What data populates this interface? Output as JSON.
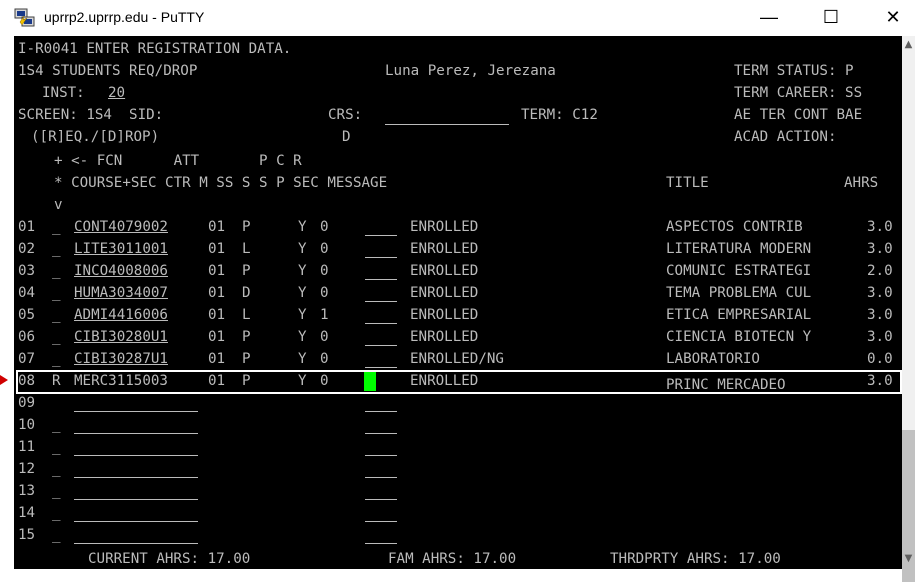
{
  "window": {
    "title": "uprrp2.uprrp.edu - PuTTY",
    "minimize_glyph": "—",
    "maximize_glyph": "☐",
    "close_glyph": "✕",
    "icon": "putty-icon"
  },
  "header": {
    "line1": "I-R0041 ENTER REGISTRATION DATA.",
    "program": "1S4 STUDENTS REQ/DROP",
    "student_name": "Luna Perez, Jerezana",
    "term_status": "TERM STATUS: P",
    "inst_label": "INST:",
    "inst_value": "20",
    "term_career": "TERM CAREER: SS",
    "screen_sid": "SCREEN: 1S4  SID:",
    "crs_label": "CRS:",
    "term_label": "TERM: C12",
    "ae_ter": "AE TER CONT BAE",
    "req_drop": "([R]EQ./[D]ROP)",
    "d_marker": "D",
    "acad_action": "ACAD ACTION:"
  },
  "columns": {
    "row1": "+ <- FCN      ATT       P C R",
    "row2": "* COURSE+SEC CTR M SS S S P SEC MESSAGE",
    "title": "TITLE",
    "ahrs": "AHRS",
    "row3": "v"
  },
  "rows": [
    {
      "num": "01",
      "fcn": "_",
      "course": "CONT4079002",
      "ctr": "01",
      "m": "P",
      "ps": "Y",
      "cs": "0",
      "message": "ENROLLED",
      "title": "ASPECTOS CONTRIB",
      "ahrs": "3.0"
    },
    {
      "num": "02",
      "fcn": "_",
      "course": "LITE3011001",
      "ctr": "01",
      "m": "L",
      "ps": "Y",
      "cs": "0",
      "message": "ENROLLED",
      "title": "LITERATURA MODERN",
      "ahrs": "3.0"
    },
    {
      "num": "03",
      "fcn": "_",
      "course": "INCO4008006",
      "ctr": "01",
      "m": "P",
      "ps": "Y",
      "cs": "0",
      "message": "ENROLLED",
      "title": "COMUNIC ESTRATEGI",
      "ahrs": "2.0"
    },
    {
      "num": "04",
      "fcn": "_",
      "course": "HUMA3034007",
      "ctr": "01",
      "m": "D",
      "ps": "Y",
      "cs": "0",
      "message": "ENROLLED",
      "title": "TEMA PROBLEMA CUL",
      "ahrs": "3.0"
    },
    {
      "num": "05",
      "fcn": "_",
      "course": "ADMI4416006",
      "ctr": "01",
      "m": "L",
      "ps": "Y",
      "cs": "1",
      "message": "ENROLLED",
      "title": "ETICA EMPRESARIAL",
      "ahrs": "3.0"
    },
    {
      "num": "06",
      "fcn": "_",
      "course": "CIBI30280U1",
      "ctr": "01",
      "m": "P",
      "ps": "Y",
      "cs": "0",
      "message": "ENROLLED",
      "title": "CIENCIA BIOTECN Y",
      "ahrs": "3.0"
    },
    {
      "num": "07",
      "fcn": "_",
      "course": "CIBI30287U1",
      "ctr": "01",
      "m": "P",
      "ps": "Y",
      "cs": "0",
      "message": "ENROLLED/NG",
      "title": "LABORATORIO",
      "ahrs": "0.0"
    },
    {
      "num": "08",
      "fcn": "R",
      "course": "MERC3115003",
      "ctr": "01",
      "m": "P",
      "ps": "Y",
      "cs": "0",
      "message": "ENROLLED",
      "title": "PRINC MERCADEO",
      "ahrs": "3.0"
    }
  ],
  "empty_rows": [
    {
      "num": "09",
      "fcn": ""
    },
    {
      "num": "10",
      "fcn": "_"
    },
    {
      "num": "11",
      "fcn": "_"
    },
    {
      "num": "12",
      "fcn": "_"
    },
    {
      "num": "13",
      "fcn": "_"
    },
    {
      "num": "14",
      "fcn": "_"
    },
    {
      "num": "15",
      "fcn": "_"
    }
  ],
  "footer": {
    "current": "CURRENT AHRS: 17.00",
    "fam": "FAM AHRS: 17.00",
    "thrdprty": "THRDPRTY AHRS: 17.00"
  },
  "scrollbar": {
    "up": "▲",
    "down": "▼"
  },
  "colors": {
    "terminal_bg": "#000000",
    "terminal_fg": "#bbbbbb",
    "cursor": "#00ff00",
    "highlight_box": "#ffffff",
    "pointer": "#d00000"
  }
}
